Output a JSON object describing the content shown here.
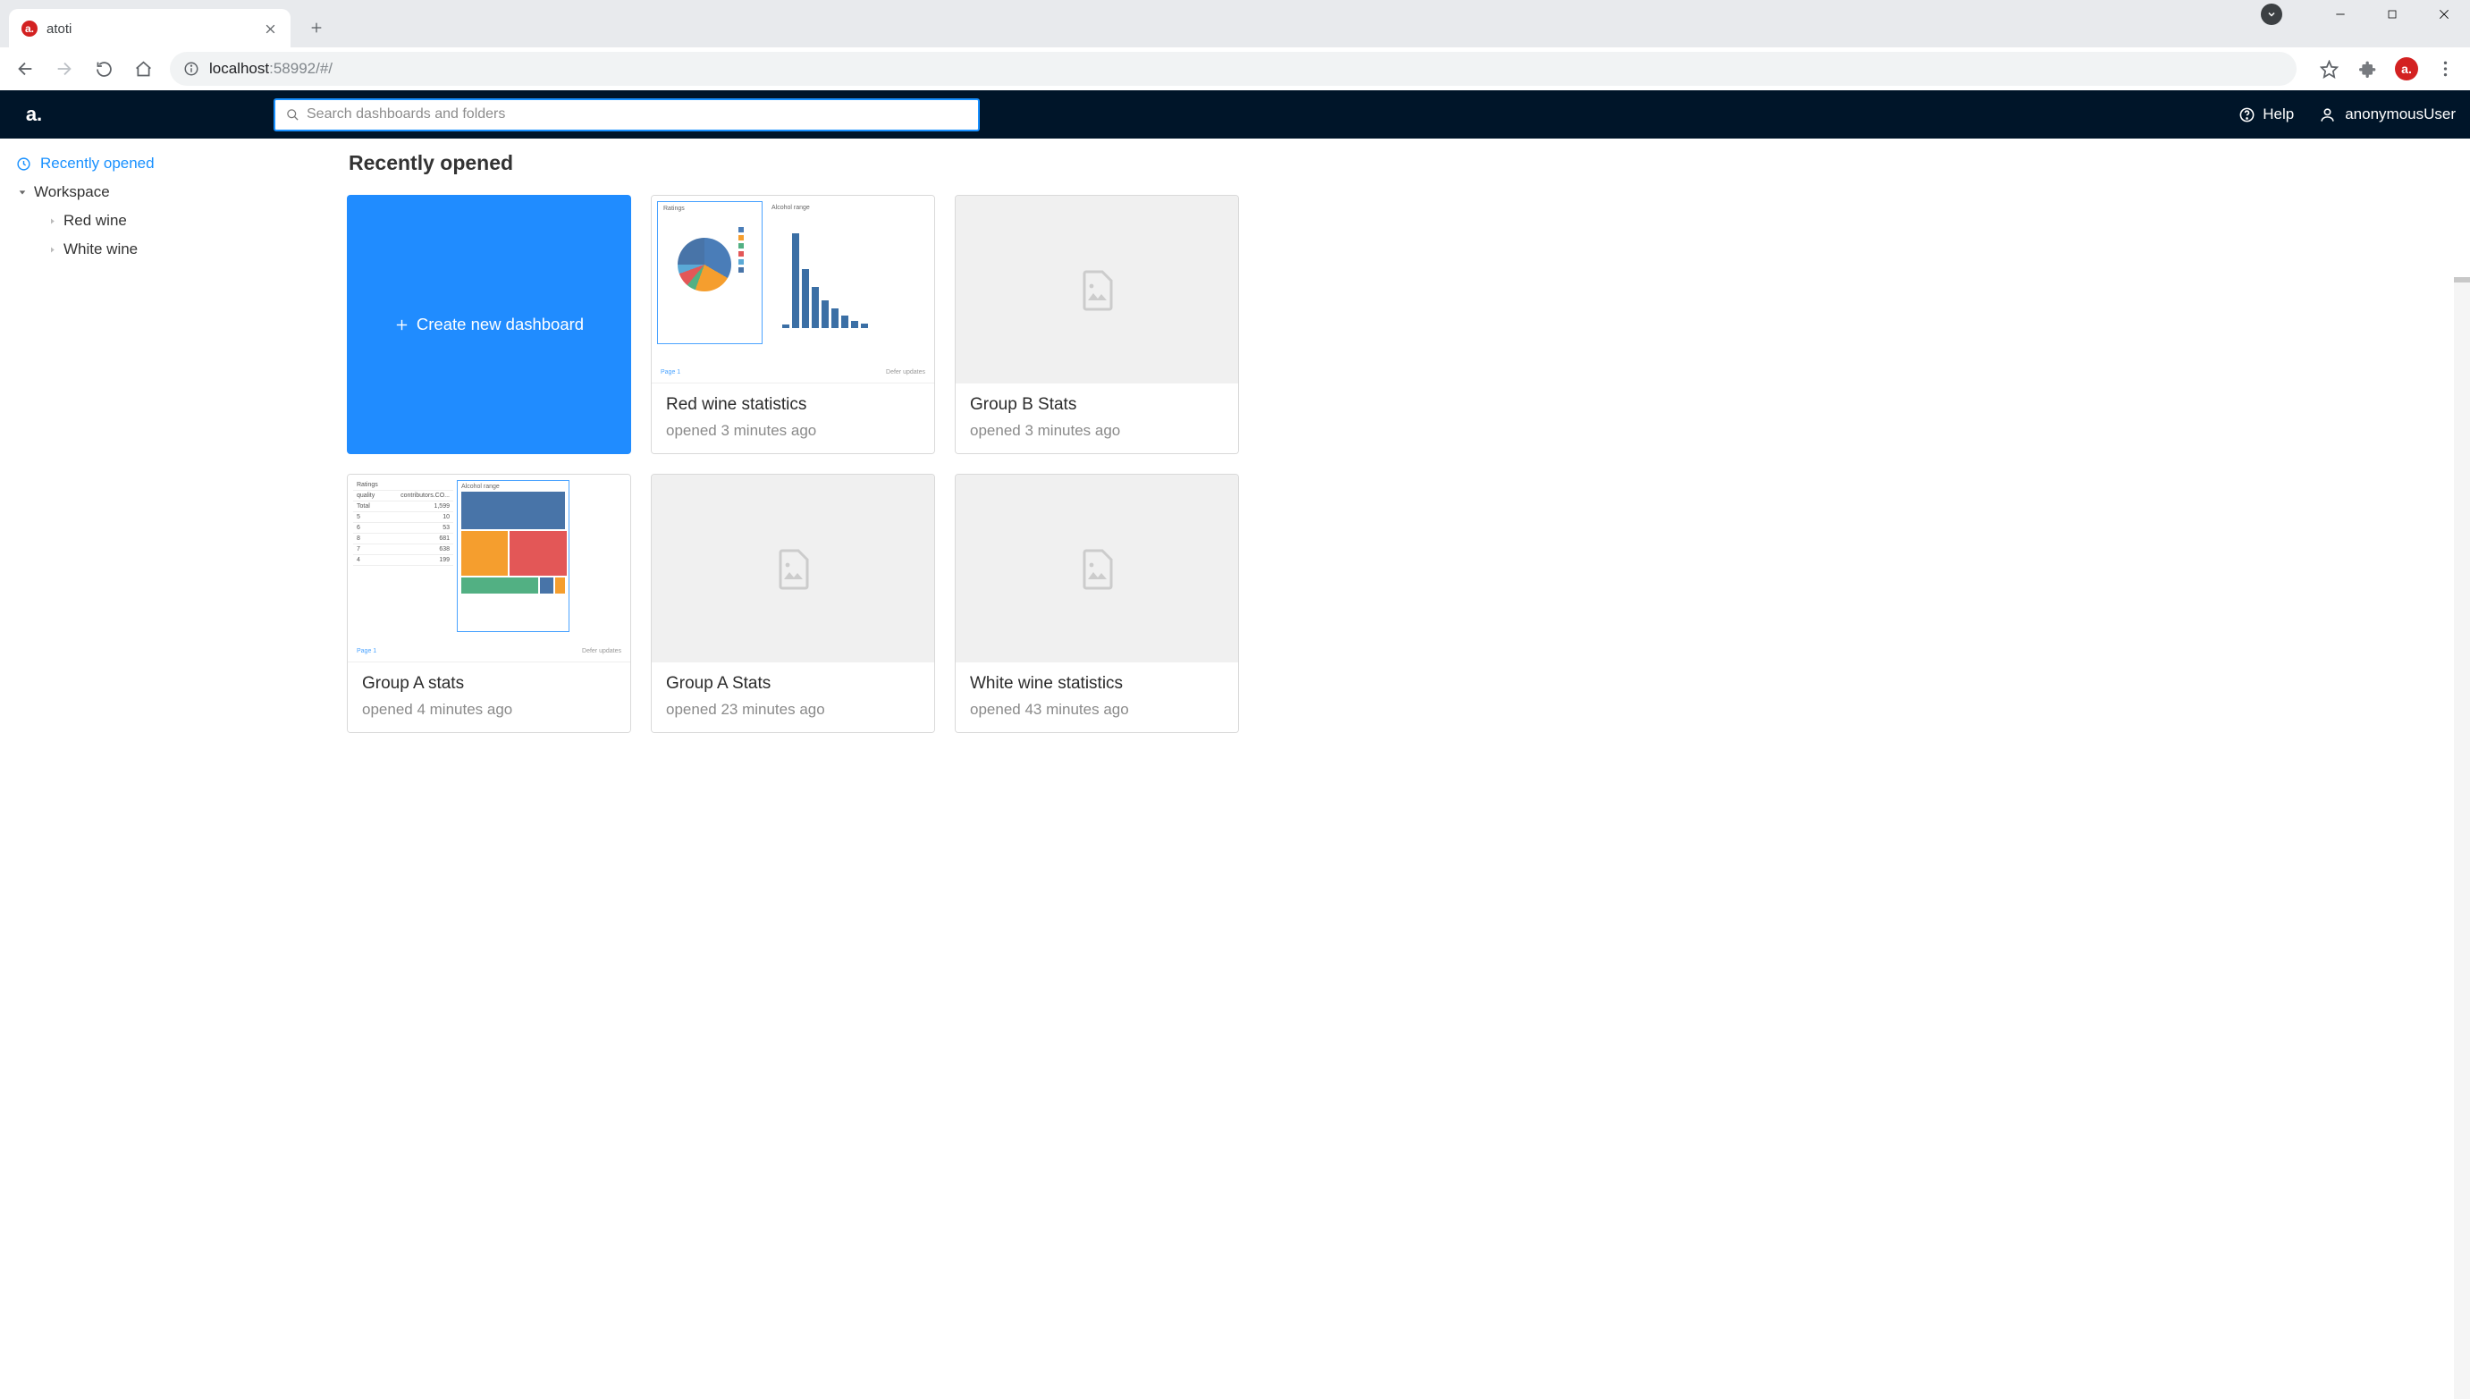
{
  "browser": {
    "tab_title": "atoti",
    "url_prefix": "localhost",
    "url_suffix": ":58992/#/"
  },
  "app": {
    "search_placeholder": "Search dashboards and folders",
    "help_label": "Help",
    "user_label": "anonymousUser"
  },
  "sidebar": {
    "recently_opened": "Recently opened",
    "workspace": "Workspace",
    "items": [
      {
        "label": "Red wine"
      },
      {
        "label": "White wine"
      }
    ]
  },
  "main": {
    "section_title": "Recently opened",
    "create_label": "Create new dashboard",
    "cards": [
      {
        "title": "Red wine statistics",
        "sub": "opened 3 minutes ago"
      },
      {
        "title": "Group B Stats",
        "sub": "opened 3 minutes ago"
      },
      {
        "title": "Group A stats",
        "sub": "opened 4 minutes ago"
      },
      {
        "title": "Group A Stats",
        "sub": "opened 23 minutes ago"
      },
      {
        "title": "White wine statistics",
        "sub": "opened 43 minutes ago"
      }
    ]
  },
  "thumb1": {
    "ratings_label": "Ratings",
    "alcohol_label": "Alcohol range",
    "page_label": "Page 1",
    "defer_label": "Defer updates"
  },
  "thumb2": {
    "ratings_label": "Ratings",
    "alcohol_label": "Alcohol range",
    "quality_label": "quality",
    "count_label": "contributors.CO...",
    "page_label": "Page 1",
    "defer_label": "Defer updates"
  }
}
